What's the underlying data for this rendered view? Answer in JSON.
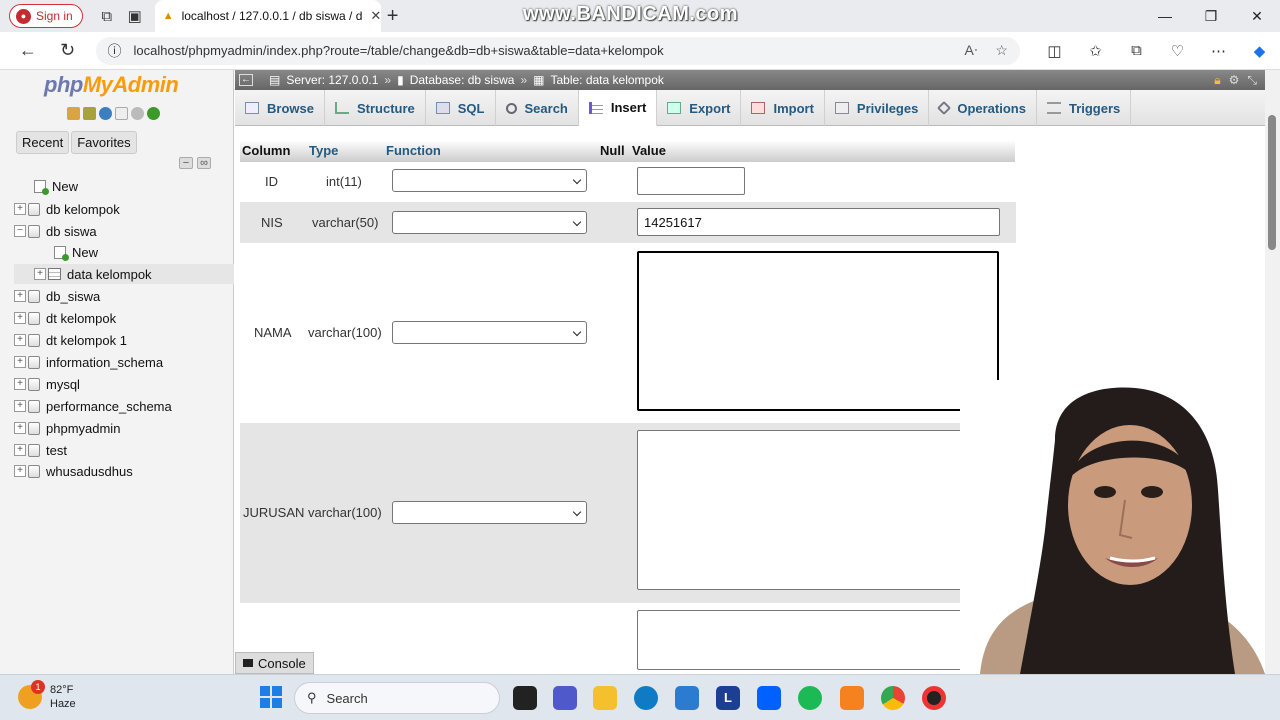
{
  "browser": {
    "signin_label": "Sign in",
    "tab_title": "localhost / 127.0.0.1 / db siswa / d",
    "url": "localhost/phpmyadmin/index.php?route=/table/change&db=db+siswa&table=data+kelompok",
    "watermark": "www.BANDICAM.com"
  },
  "logo": {
    "php": "php",
    "admin": "MyAdmin"
  },
  "sidebar": {
    "recent_label": "Recent",
    "favorites_label": "Favorites",
    "tree": [
      {
        "label": "New",
        "kind": "new",
        "level": 0
      },
      {
        "label": "db kelompok",
        "kind": "db",
        "level": 0
      },
      {
        "label": "db siswa",
        "kind": "db-open",
        "level": 0
      },
      {
        "label": "New",
        "kind": "new",
        "level": 1
      },
      {
        "label": "data kelompok",
        "kind": "table",
        "level": 1
      },
      {
        "label": "db_siswa",
        "kind": "db",
        "level": 0
      },
      {
        "label": "dt kelompok",
        "kind": "db",
        "level": 0
      },
      {
        "label": "dt kelompok 1",
        "kind": "db",
        "level": 0
      },
      {
        "label": "information_schema",
        "kind": "db",
        "level": 0
      },
      {
        "label": "mysql",
        "kind": "db",
        "level": 0
      },
      {
        "label": "performance_schema",
        "kind": "db",
        "level": 0
      },
      {
        "label": "phpmyadmin",
        "kind": "db",
        "level": 0
      },
      {
        "label": "test",
        "kind": "db",
        "level": 0
      },
      {
        "label": "whusadusdhus",
        "kind": "db",
        "level": 0
      }
    ]
  },
  "breadcrumb": {
    "server": "Server: 127.0.0.1",
    "database": "Database: db siswa",
    "table": "Table: data kelompok"
  },
  "tabs": [
    {
      "label": "Browse",
      "icon": "browse-icon"
    },
    {
      "label": "Structure",
      "icon": "structure-icon"
    },
    {
      "label": "SQL",
      "icon": "sql-icon"
    },
    {
      "label": "Search",
      "icon": "search-icon"
    },
    {
      "label": "Insert",
      "icon": "insert-icon",
      "active": true
    },
    {
      "label": "Export",
      "icon": "export-icon"
    },
    {
      "label": "Import",
      "icon": "import-icon"
    },
    {
      "label": "Privileges",
      "icon": "privileges-icon"
    },
    {
      "label": "Operations",
      "icon": "operations-icon"
    },
    {
      "label": "Triggers",
      "icon": "triggers-icon"
    }
  ],
  "insert_form": {
    "headers": {
      "column": "Column",
      "type": "Type",
      "function": "Function",
      "null": "Null",
      "value": "Value"
    },
    "rows": [
      {
        "column": "ID",
        "type": "int(11)",
        "value": ""
      },
      {
        "column": "NIS",
        "type": "varchar(50)",
        "value": "14251617"
      },
      {
        "column": "NAMA",
        "type": "varchar(100)",
        "value": ""
      },
      {
        "column": "JURUSAN",
        "type": "varchar(100)",
        "value": ""
      }
    ]
  },
  "console_label": "Console",
  "taskbar": {
    "temperature": "82°F",
    "condition": "Haze",
    "notification_count": "1",
    "search_label": "Search"
  },
  "colors": {
    "php_blue": "#6c78af",
    "admin_orange": "#f89c0e",
    "link_blue": "#235a81"
  }
}
